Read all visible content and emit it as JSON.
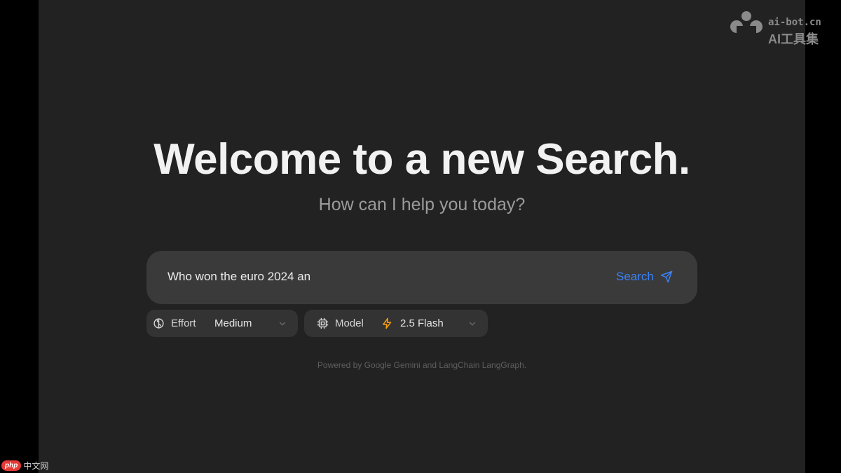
{
  "hero": {
    "title": "Welcome to a new Search.",
    "subtitle": "How can I help you today?"
  },
  "search": {
    "value": "Who won the euro 2024 an",
    "button_label": "Search",
    "button_icon": "send-icon"
  },
  "options": {
    "effort": {
      "icon": "brain-icon",
      "label": "Effort",
      "value": "Medium"
    },
    "model": {
      "icon": "cpu-icon",
      "label": "Model",
      "value_icon": "lightning-icon",
      "value": "2.5 Flash"
    }
  },
  "footer": {
    "text": "Powered by Google Gemini and LangChain LangGraph."
  },
  "watermarks": {
    "top_domain": "ai-bot.cn",
    "top_name": "AI工具集",
    "bottom_badge": "php",
    "bottom_text": "中文网"
  },
  "colors": {
    "background": "#222222",
    "input_bg": "#3a3a3a",
    "accent_blue": "#3b82f6",
    "accent_orange": "#f59e0b"
  }
}
